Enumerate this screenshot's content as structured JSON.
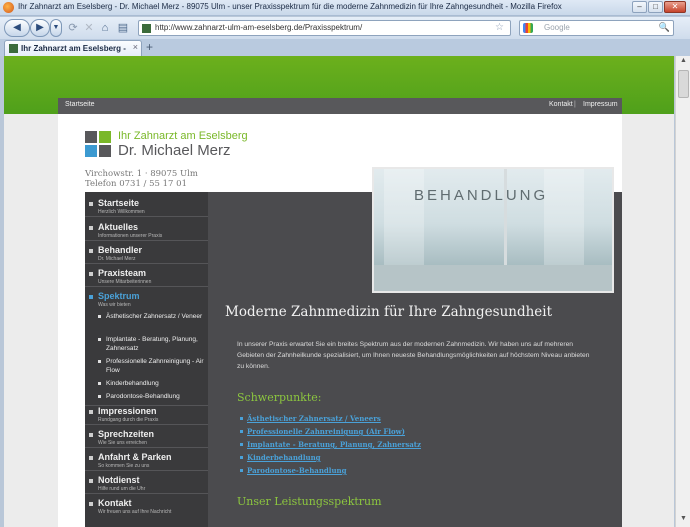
{
  "window": {
    "title": "Ihr Zahnarzt am Eselsberg - Dr. Michael Merz - 89075 Ulm - unser Praxisspektrum für die moderne Zahnmedizin für Ihre Zahngesundheit - Mozilla Firefox",
    "minimize": "–",
    "maximize": "□",
    "close": "✕"
  },
  "toolbar": {
    "back": "◀",
    "forward": "▶",
    "dropdown": "▼",
    "reload": "⟳",
    "stop": "✕",
    "home": "⌂",
    "bookmarks": "▤",
    "url": "http://www.zahnarzt-ulm-am-eselsberg.de/Praxisspektrum/",
    "star": "☆",
    "search_placeholder": "Google",
    "search_go": "🔍"
  },
  "tabs": [
    {
      "title": "Ihr Zahnarzt am Eselsberg - Dr. Mi...",
      "close": "×"
    }
  ],
  "new_tab": "+",
  "site": {
    "topnav": {
      "home": "Startseite",
      "kontakt": "Kontakt",
      "sep": "|",
      "impressum": "Impressum"
    },
    "logo": {
      "line1": "Ihr Zahnarzt am Eselsberg",
      "line2": "Dr. Michael Merz"
    },
    "address": {
      "street": "Virchowstr. 1 · 89075 Ulm",
      "phone": "Telefon 0731 / 55 17 01"
    },
    "photo_label": "BEHANDLUNG",
    "menu": [
      {
        "title": "Startseite",
        "subtitle": "Herzlich Willkommen"
      },
      {
        "title": "Aktuelles",
        "subtitle": "Informationen unserer Praxis"
      },
      {
        "title": "Behandler",
        "subtitle": "Dr. Michael Merz"
      },
      {
        "title": "Praxisteam",
        "subtitle": "Unsere Mitarbeiterinnen"
      },
      {
        "title": "Spektrum",
        "subtitle": "Was wir bieten"
      },
      {
        "title": "Impressionen",
        "subtitle": "Rundgang durch die Praxis"
      },
      {
        "title": "Sprechzeiten",
        "subtitle": "Wie Sie uns erreichen"
      },
      {
        "title": "Anfahrt & Parken",
        "subtitle": "So kommen Sie zu uns"
      },
      {
        "title": "Notdienst",
        "subtitle": "Hilfe rund um die Uhr"
      },
      {
        "title": "Kontakt",
        "subtitle": "Wir freuen uns auf Ihre Nachricht"
      }
    ],
    "submenu": [
      "Ästhetischer Zahnersatz / Veneer",
      "Implantate - Beratung, Planung, Zahnersatz",
      "Professionelle Zahnreinigung - Air Flow",
      "Kinderbehandlung",
      "Parodontose-Behandlung"
    ],
    "heading": "Moderne Zahnmedizin für Ihre Zahngesundheit",
    "intro": "In unserer Praxis erwartet Sie ein breites Spektrum aus der modernen Zahnmedizin. Wir haben uns auf mehreren Gebieten der Zahnheilkunde spezialisiert, um Ihnen neueste Behandlungsmöglichkeiten auf höchstem Niveau anbieten zu können.",
    "schwerpunkte_title": "Schwerpunkte:",
    "schwerpunkte": [
      "Ästhetischer Zahnersatz / Veneers",
      "Professionelle Zahnreinigung (Air Flow)",
      "Implantate - Beratung, Planung, Zahnersatz",
      "Kinderbehandlung",
      "Parodontose-Behandlung"
    ],
    "leistung_title": "Unser Leistungsspektrum"
  },
  "colors": {
    "green": "#6cb01c",
    "blue": "#4aa1d8",
    "dark": "#3a3a3c"
  }
}
